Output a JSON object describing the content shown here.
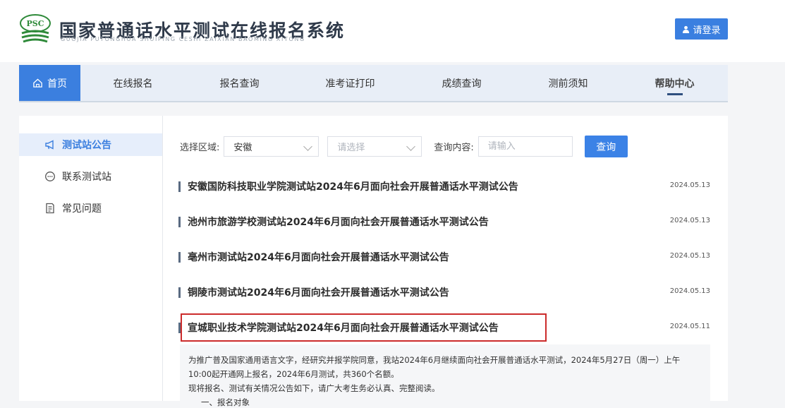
{
  "header": {
    "logo_text": "PSC",
    "title": "国家普通话水平测试在线报名系统",
    "subtitle": "GUOJIA PUTONGHUA SHUIPING CESHI ZAIXIAN BAOMING XITONG",
    "login_label": "请登录"
  },
  "nav": {
    "items": [
      "首页",
      "在线报名",
      "报名查询",
      "准考证打印",
      "成绩查询",
      "测前须知",
      "帮助中心"
    ]
  },
  "sidebar": {
    "items": [
      "测试站公告",
      "联系测试站",
      "常见问题"
    ]
  },
  "filters": {
    "region_label": "选择区域:",
    "region_value": "安徽",
    "city_placeholder": "请选择",
    "query_label": "查询内容:",
    "query_placeholder": "请输入",
    "query_button": "查询"
  },
  "notices": [
    {
      "title": "安徽国防科技职业学院测试站2024年6月面向社会开展普通话水平测试公告",
      "date": "2024.05.13"
    },
    {
      "title": "池州市旅游学校测试站2024年6月面向社会开展普通话水平测试公告",
      "date": "2024.05.13"
    },
    {
      "title": "亳州市测试站2024年6月面向社会开展普通话水平测试公告",
      "date": "2024.05.13"
    },
    {
      "title": "铜陵市测试站2024年6月面向社会开展普通话水平测试公告",
      "date": "2024.05.13"
    },
    {
      "title": "宣城职业技术学院测试站2024年6月面向社会开展普通话水平测试公告",
      "date": "2024.05.11"
    }
  ],
  "detail": {
    "line1": "为推广普及国家通用语言文字，经研究并报学院同意，我站2024年6月继续面向社会开展普通话水平测试，2024年5月27日（周一）上午",
    "line2": "10:00起开通网上报名，2024年6月测试，共360个名额。",
    "line3": "现将报名、测试有关情况公告如下，请广大考生务必认真、完整阅读。",
    "line4": "一、报名对象"
  },
  "colors": {
    "accent": "#3b7fdf",
    "highlight_border": "#cc2b2b"
  }
}
